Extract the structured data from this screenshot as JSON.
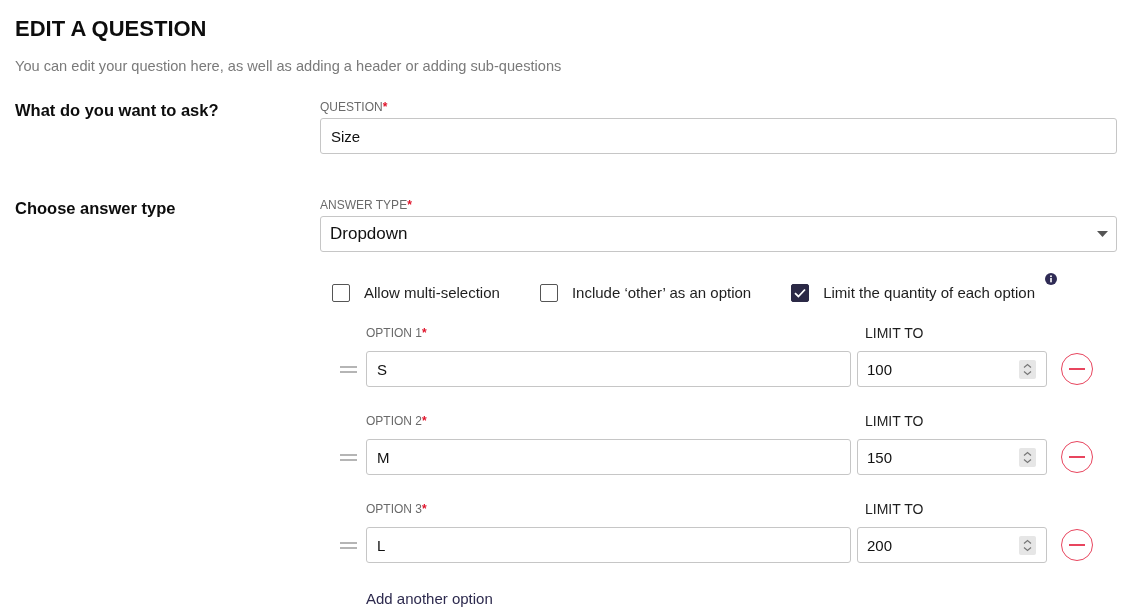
{
  "header": {
    "title": "EDIT A QUESTION",
    "subtitle": "You can edit your question here, as well as adding a header or adding sub-questions"
  },
  "sections": [
    {
      "heading": "What do you want to ask?",
      "field": {
        "kind": "text",
        "label": "QUESTION",
        "required_mark": "*",
        "value": "Size"
      }
    },
    {
      "heading": "Choose answer type",
      "field": {
        "kind": "select",
        "label": "ANSWER TYPE",
        "required_mark": "*",
        "value": "Dropdown"
      },
      "settings": [
        {
          "label": "Allow multi-selection",
          "checked": false,
          "has_info": false
        },
        {
          "label": "Include ‘other’ as an option",
          "checked": false,
          "has_info": false
        },
        {
          "label": "Limit the quantity of each option",
          "checked": true,
          "has_info": true
        }
      ],
      "options": [
        {
          "label": "OPTION 1",
          "required_mark": "*",
          "value": "S",
          "limit_label": "LIMIT TO",
          "limit": "100"
        },
        {
          "label": "OPTION 2",
          "required_mark": "*",
          "value": "M",
          "limit_label": "LIMIT TO",
          "limit": "150"
        },
        {
          "label": "OPTION 3",
          "required_mark": "*",
          "value": "L",
          "limit_label": "LIMIT TO",
          "limit": "200"
        }
      ],
      "add_option": "Add another option"
    }
  ]
}
